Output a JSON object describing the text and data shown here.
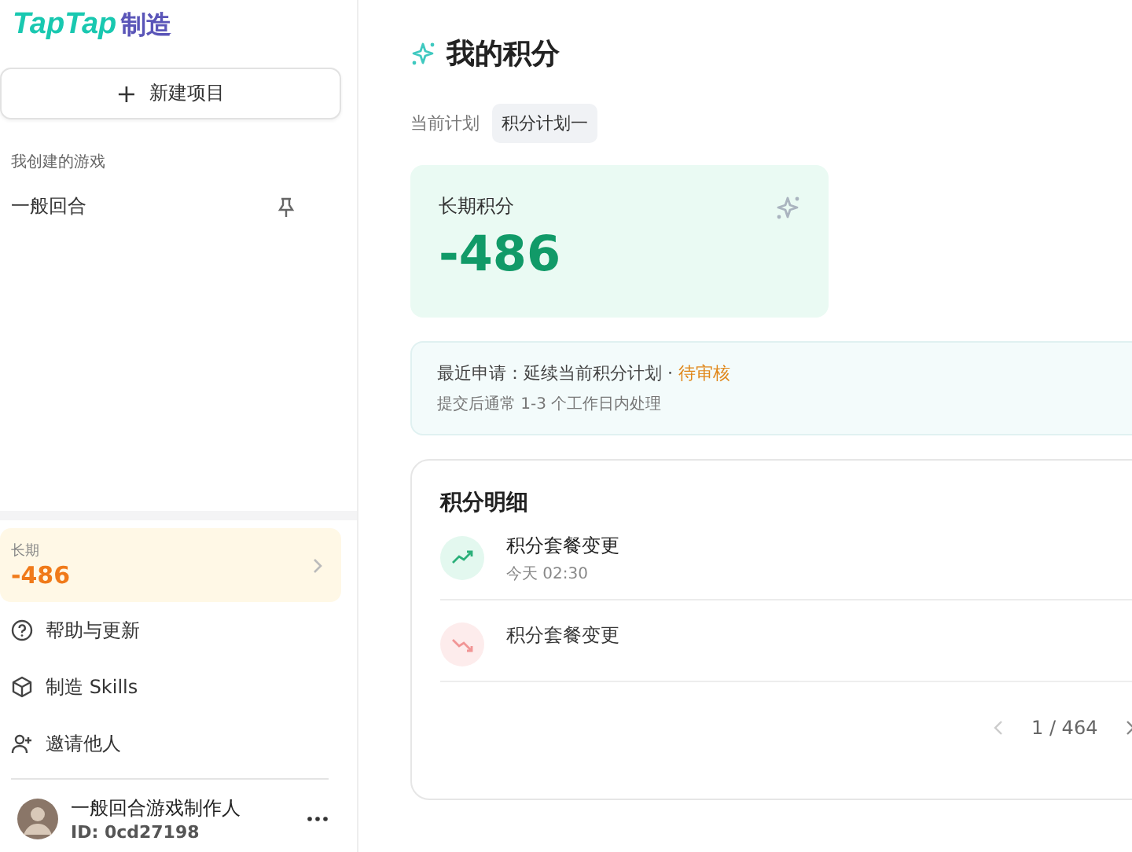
{
  "sidebar": {
    "logo": {
      "brand": "TapTap",
      "suffix": "制造"
    },
    "new_button": {
      "label": "新建项目",
      "icon": "+"
    },
    "section_label": "我创建的游戏",
    "games": [
      {
        "name": "一般回合",
        "pinned": true
      }
    ],
    "points": {
      "label": "长期",
      "value": "-486"
    },
    "menu": [
      {
        "kind": "help",
        "label": "帮助与更新"
      },
      {
        "kind": "box",
        "label": "制造 Skills"
      },
      {
        "kind": "invite",
        "label": "邀请他人"
      }
    ],
    "user": {
      "name": "一般回合游戏制作人",
      "id": "ID: 0cd27198"
    }
  },
  "main": {
    "title": "我的积分",
    "plan": {
      "label": "当前计划",
      "value": "积分计划一"
    },
    "balance": {
      "label": "长期积分",
      "value": "-486"
    },
    "notice": {
      "prefix": "最近申请：延续当前积分计划 · ",
      "status": "待审核",
      "note": "提交后通常 1-3 个工作日内处理"
    },
    "details": {
      "title": "积分明细",
      "rows": [
        {
          "kind": "up",
          "title": "积分套餐变更",
          "time": "今天 02:30"
        },
        {
          "kind": "down",
          "title": "积分套餐变更"
        }
      ],
      "pager": "1 / 464"
    }
  }
}
